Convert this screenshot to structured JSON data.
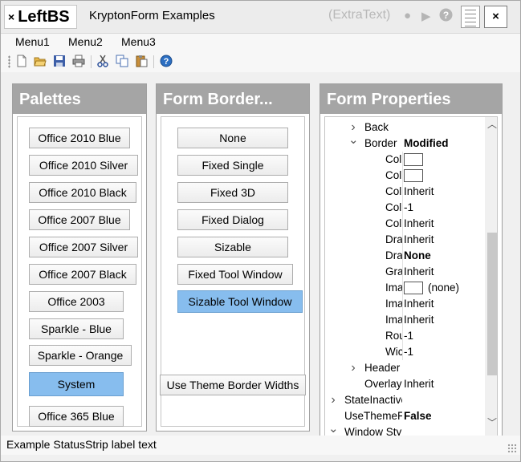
{
  "title_bar": {
    "close_glyph": "×",
    "app_name": "LeftBS",
    "title": "KryptonForm Examples",
    "extra_text": "(ExtraText)",
    "close_button": "×"
  },
  "menu": {
    "items": [
      "Menu1",
      "Menu2",
      "Menu3"
    ]
  },
  "toolbar": {
    "icons": [
      "new-document-icon",
      "open-folder-icon",
      "save-icon",
      "print-icon",
      "cut-icon",
      "copy-icon",
      "paste-icon",
      "help-icon"
    ]
  },
  "palettes": {
    "title": "Palettes",
    "buttons": [
      "Office 2010 Blue",
      "Office 2010 Silver",
      "Office 2010 Black",
      "Office 2007 Blue",
      "Office 2007 Silver",
      "Office 2007 Black",
      "Office 2003",
      "Sparkle - Blue",
      "Sparkle - Orange",
      "System",
      "Office 365 Blue"
    ],
    "selected": "System"
  },
  "form_border": {
    "title": "Form  Border...",
    "buttons": [
      "None",
      "Fixed Single",
      "Fixed 3D",
      "Fixed Dialog",
      "Sizable",
      "Fixed Tool Window",
      "Sizable Tool Window"
    ],
    "selected": "Sizable Tool Window",
    "theme_button": "Use Theme Border Widths"
  },
  "form_properties": {
    "title": "Form Properties",
    "rows": [
      {
        "name": "Back",
        "value": "",
        "indent": 1,
        "expander": "collapsed",
        "bold": false,
        "swatch": false
      },
      {
        "name": "Border",
        "value": "Modified",
        "indent": 1,
        "expander": "expanded",
        "bold": true,
        "swatch": false
      },
      {
        "name": "Col",
        "value": "",
        "indent": 2,
        "expander": "",
        "bold": false,
        "swatch": true
      },
      {
        "name": "Col",
        "value": "",
        "indent": 2,
        "expander": "",
        "bold": false,
        "swatch": true
      },
      {
        "name": "Col",
        "value": "Inherit",
        "indent": 2,
        "expander": "",
        "bold": false,
        "swatch": false
      },
      {
        "name": "Col",
        "value": "-1",
        "indent": 2,
        "expander": "",
        "bold": false,
        "swatch": false
      },
      {
        "name": "Col",
        "value": "Inherit",
        "indent": 2,
        "expander": "",
        "bold": false,
        "swatch": false
      },
      {
        "name": "Dra",
        "value": "Inherit",
        "indent": 2,
        "expander": "",
        "bold": false,
        "swatch": false
      },
      {
        "name": "Dra",
        "value": "None",
        "indent": 2,
        "expander": "",
        "bold": true,
        "swatch": false
      },
      {
        "name": "Gra",
        "value": "Inherit",
        "indent": 2,
        "expander": "",
        "bold": false,
        "swatch": false
      },
      {
        "name": "Ima",
        "value": "(none)",
        "indent": 2,
        "expander": "",
        "bold": false,
        "swatch": true
      },
      {
        "name": "Ima",
        "value": "Inherit",
        "indent": 2,
        "expander": "",
        "bold": false,
        "swatch": false
      },
      {
        "name": "Ima",
        "value": "Inherit",
        "indent": 2,
        "expander": "",
        "bold": false,
        "swatch": false
      },
      {
        "name": "Rou",
        "value": "-1",
        "indent": 2,
        "expander": "",
        "bold": false,
        "swatch": false
      },
      {
        "name": "Wic",
        "value": "-1",
        "indent": 2,
        "expander": "",
        "bold": false,
        "swatch": false
      },
      {
        "name": "Header",
        "value": "",
        "indent": 1,
        "expander": "collapsed",
        "bold": false,
        "swatch": false
      },
      {
        "name": "Overlay",
        "value": "Inherit",
        "indent": 1,
        "expander": "",
        "bold": false,
        "swatch": false
      },
      {
        "name": "StateInactive",
        "value": "",
        "indent": 0,
        "expander": "collapsed",
        "bold": false,
        "swatch": false
      },
      {
        "name": "UseThemeF",
        "value": "False",
        "indent": 0,
        "expander": "",
        "bold": true,
        "swatch": false
      },
      {
        "name": "Window Style",
        "value": "",
        "indent": 0,
        "expander": "expanded",
        "bold": true,
        "swatch": false
      }
    ]
  },
  "status": {
    "label": "Example StatusStrip label text"
  }
}
